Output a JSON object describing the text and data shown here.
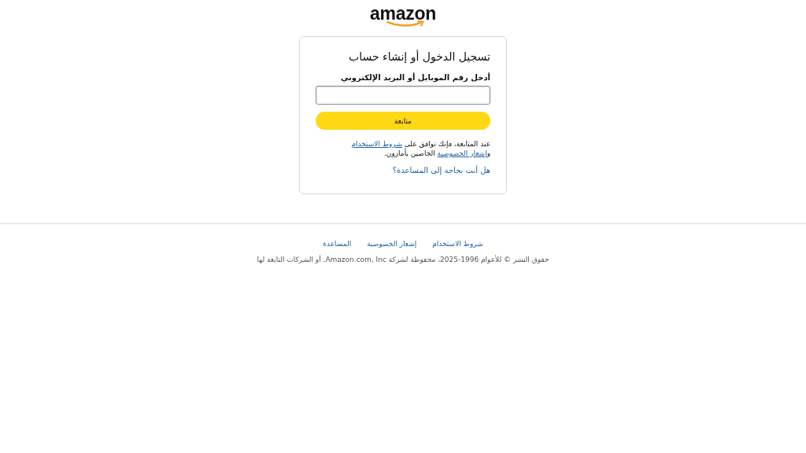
{
  "logo": {
    "text": "amazon"
  },
  "card": {
    "title": "تسجيل الدخول أو إنشاء حساب",
    "field_label": "أدخل رقم الموبايل أو البريد الإلكتروني",
    "continue_button": "متابعة",
    "legal": [
      {
        "kind": "text",
        "text": "عند المتابعة، فإنك توافق على "
      },
      {
        "kind": "link",
        "text": "شروط الاستخدام"
      },
      {
        "kind": "text",
        "text": " و"
      },
      {
        "kind": "link",
        "text": "إشعار الخصوصية"
      },
      {
        "kind": "text",
        "text": " الخاصين بأمازون."
      }
    ],
    "help_link": "هل أنت بحاجة إلى المساعدة؟"
  },
  "footer": {
    "links": [
      "شروط الاستخدام",
      "إشعار الخصوصية",
      "المساعدة"
    ],
    "copyright": "حقوق النشر © للأعوام 1996-2025، محفوظة لشركة Amazon.com, Inc. أو الشركات التابعة لها"
  }
}
